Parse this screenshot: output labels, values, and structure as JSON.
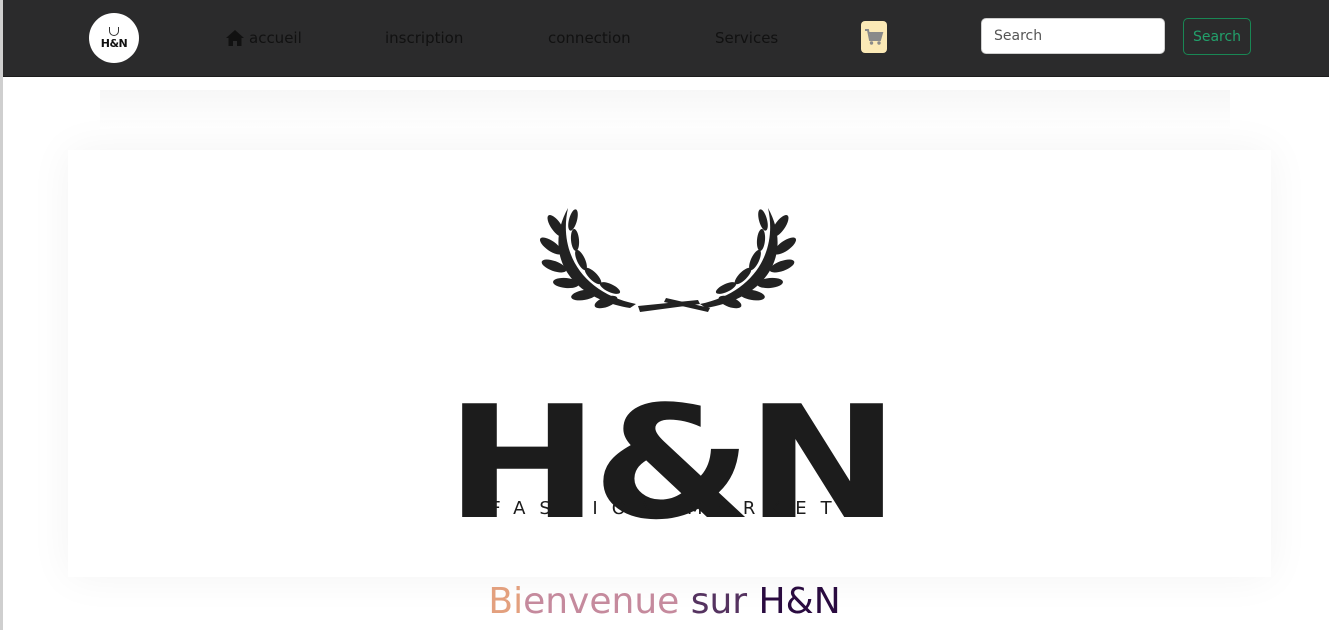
{
  "navbar": {
    "brand": {
      "text": "H&N"
    },
    "links": [
      {
        "label": "accueil",
        "icon": "home-icon"
      },
      {
        "label": "inscription"
      },
      {
        "label": "connection"
      },
      {
        "label": "Services"
      }
    ],
    "cart": {
      "icon": "cart-icon"
    },
    "search": {
      "placeholder": "Search",
      "button_label": "Search"
    }
  },
  "hero": {
    "logo_text": "H&N",
    "logo_subtitle": "FASHION MARKET"
  },
  "welcome": {
    "part1": "Bi",
    "part2": "envenue",
    "part3": " sur ",
    "part4": "H&N"
  },
  "colors": {
    "navbar_bg": "#2b2b2c",
    "cart_bg": "#fbe9b6",
    "search_button": "#198754",
    "welcome_gradient": [
      "#e3a07e",
      "#c58a9d",
      "#553360",
      "#2a0b40"
    ]
  }
}
